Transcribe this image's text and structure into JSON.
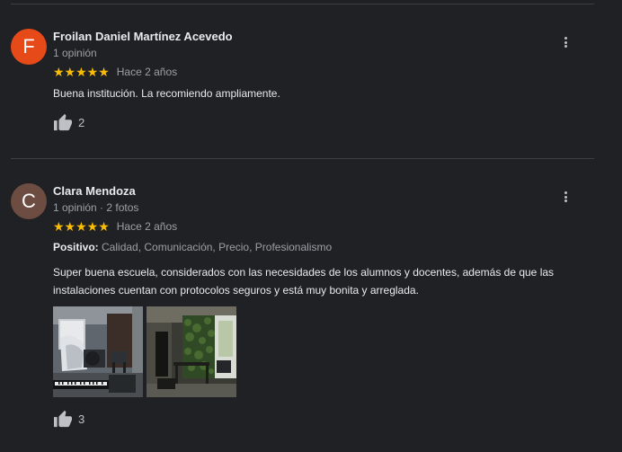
{
  "reviews": [
    {
      "avatar_letter": "F",
      "avatar_color": "#e64a19",
      "name": "Froilan Daniel Martínez Acevedo",
      "meta": "1 opinión",
      "stars": "★★★★★",
      "when": "Hace 2 años",
      "text": "Buena institución. La recomiendo ampliamente.",
      "likes": "2"
    },
    {
      "avatar_letter": "C",
      "avatar_color": "#6d4c41",
      "name": "Clara Mendoza",
      "meta": "1 opinión · 2 fotos",
      "stars": "★★★★★",
      "when": "Hace 2 años",
      "attributes_label": "Positivo:",
      "attributes": "Calidad, Comunicación, Precio, Profesionalismo",
      "text": "Super buena escuela, considerados con las necesidades de los alumnos y docentes, además de que las instalaciones cuentan con protocolos seguros y está muy bonita y arreglada.",
      "photos": [
        "classroom-photo",
        "entrance-photo"
      ],
      "likes": "3"
    }
  ],
  "colors": {
    "background": "#202124",
    "star": "#fbbc04",
    "divider": "#3c4043"
  }
}
